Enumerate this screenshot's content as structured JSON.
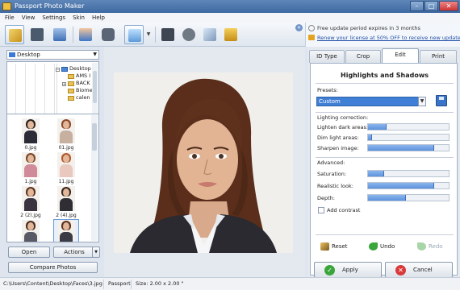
{
  "window": {
    "title": "Passport Photo Maker"
  },
  "menu": [
    "File",
    "View",
    "Settings",
    "Skin",
    "Help"
  ],
  "toolbar": {
    "icons": [
      "open-wizard-icon",
      "save-icon",
      "print-icon",
      "user-contact-icon",
      "camera-icon",
      "image-display-icon",
      "book-icon",
      "film-reel-icon",
      "photo-transfer-icon",
      "shopping-cart-icon"
    ]
  },
  "notice": {
    "line1": "Free update period expires in 3 months",
    "line2": "Renew your license at 50% OFF to receive new updates"
  },
  "folder": {
    "current": "Desktop"
  },
  "tree": {
    "items": [
      "Desktop",
      "AMS I",
      "BACK",
      "Biome",
      "calen"
    ]
  },
  "thumbnails": [
    {
      "label": "0.jpg"
    },
    {
      "label": "01.jpg"
    },
    {
      "label": "1.jpg"
    },
    {
      "label": "11.jpg"
    },
    {
      "label": "2 (2).jpg"
    },
    {
      "label": "2 (4).jpg"
    },
    {
      "label": ""
    },
    {
      "label": ""
    }
  ],
  "left_buttons": {
    "open": "Open",
    "actions": "Actions",
    "compare": "Compare Photos"
  },
  "tabs": [
    {
      "label": "ID Type",
      "active": false
    },
    {
      "label": "Crop",
      "active": false
    },
    {
      "label": "Edit",
      "active": true
    },
    {
      "label": "Print",
      "active": false
    }
  ],
  "edit": {
    "title": "Highlights and Shadows",
    "presets_label": "Presets:",
    "preset_value": "Custom",
    "lighting_label": "Lighting correction:",
    "lighting": [
      {
        "label": "Lighten dark areas:",
        "value": 0.23
      },
      {
        "label": "Dim light areas:",
        "value": 0.05
      },
      {
        "label": "Sharpen image:",
        "value": 0.82
      }
    ],
    "advanced_label": "Advanced:",
    "advanced": [
      {
        "label": "Saturation:",
        "value": 0.2
      },
      {
        "label": "Realistic look:",
        "value": 0.82
      },
      {
        "label": "Depth:",
        "value": 0.47
      }
    ],
    "add_contrast": "Add contrast",
    "reset": "Reset",
    "undo": "Undo",
    "redo": "Redo",
    "apply": "Apply",
    "cancel": "Cancel"
  },
  "status": {
    "path": "C:\\Users\\Content\\Desktop\\Faces\\3.jpg",
    "type": "Passport",
    "size": "Size: 2.00 x 2.00 \""
  }
}
